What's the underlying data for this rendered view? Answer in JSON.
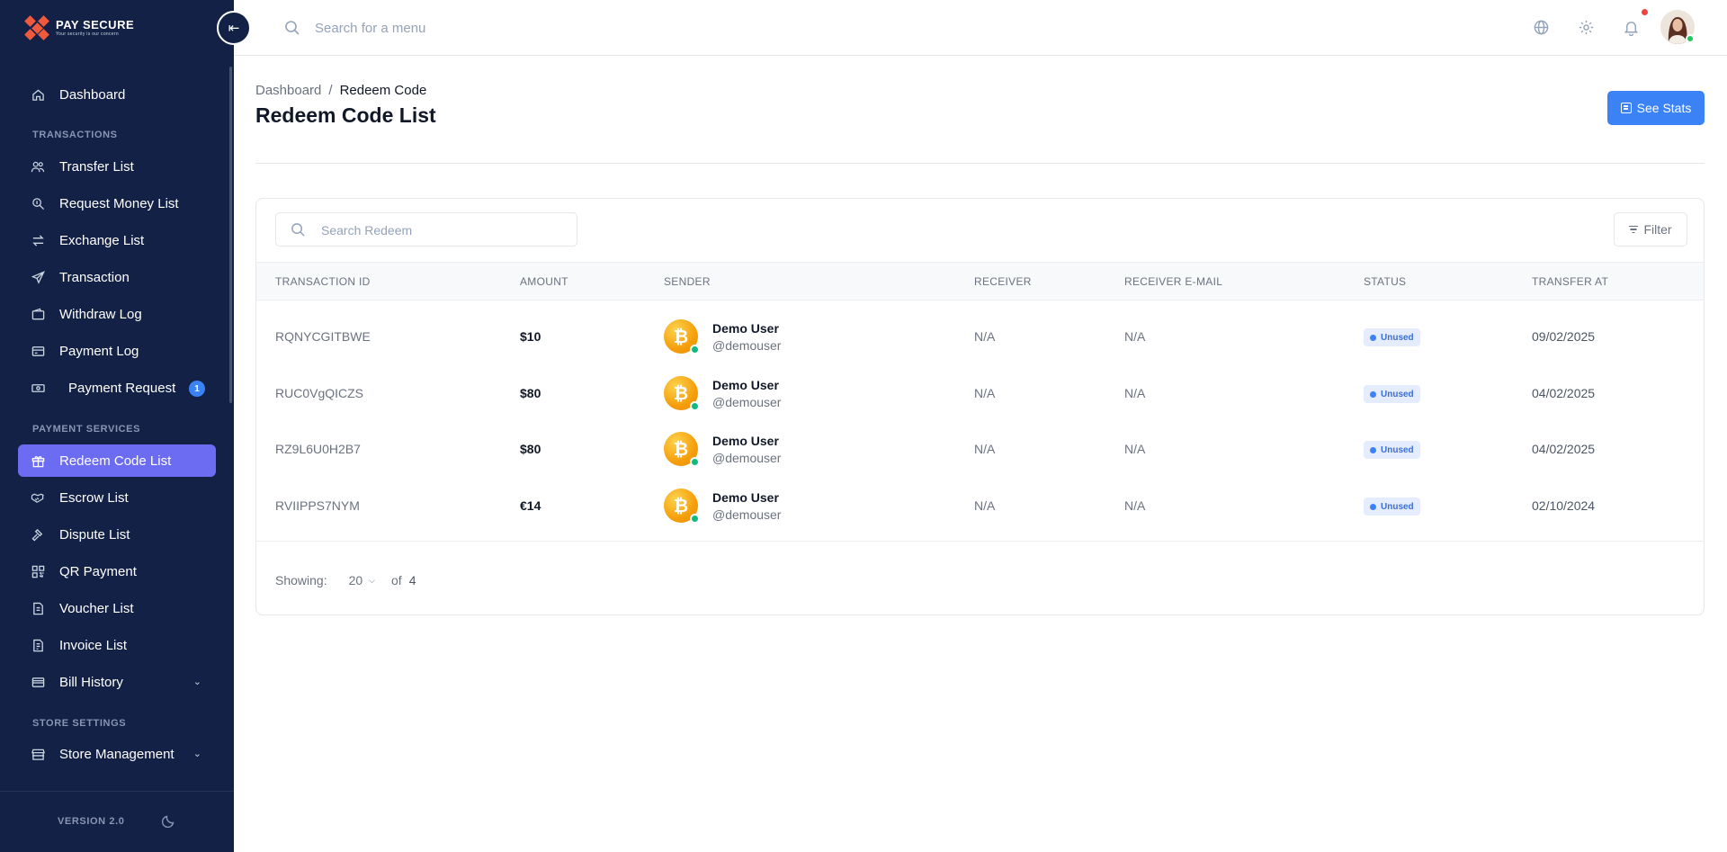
{
  "brand": {
    "name": "PAY SECURE",
    "tagline": "Your security is our concern"
  },
  "topbar": {
    "search_placeholder": "Search for a menu"
  },
  "sidebar": {
    "dashboard": "Dashboard",
    "section_transactions": "TRANSACTIONS",
    "transactions": [
      "Transfer List",
      "Request Money List",
      "Exchange List",
      "Transaction",
      "Withdraw Log",
      "Payment Log",
      "Payment Request"
    ],
    "payment_request_badge": "1",
    "section_payment_services": "PAYMENT SERVICES",
    "payment_services": [
      "Redeem Code List",
      "Escrow List",
      "Dispute List",
      "QR Payment",
      "Voucher List",
      "Invoice List",
      "Bill History"
    ],
    "section_store_settings": "STORE SETTINGS",
    "store_management": "Store Management",
    "version": "VERSION 2.0",
    "active_item": "Redeem Code List"
  },
  "breadcrumb": {
    "parent": "Dashboard",
    "separator": "/",
    "current": "Redeem Code"
  },
  "page_title": "Redeem Code List",
  "see_stats_label": "See Stats",
  "table": {
    "search_placeholder": "Search Redeem",
    "filter_label": "Filter",
    "columns": [
      "TRANSACTION ID",
      "AMOUNT",
      "SENDER",
      "RECEIVER",
      "RECEIVER E-MAIL",
      "STATUS",
      "TRANSFER AT"
    ],
    "rows": [
      {
        "id": "RQNYCGITBWE",
        "amount": "$10",
        "sender_name": "Demo User",
        "sender_username": "@demouser",
        "receiver": "N/A",
        "receiver_email": "N/A",
        "status": "Unused",
        "date": "09/02/2025"
      },
      {
        "id": "RUC0VgQICZS",
        "amount": "$80",
        "sender_name": "Demo User",
        "sender_username": "@demouser",
        "receiver": "N/A",
        "receiver_email": "N/A",
        "status": "Unused",
        "date": "04/02/2025"
      },
      {
        "id": "RZ9L6U0H2B7",
        "amount": "$80",
        "sender_name": "Demo User",
        "sender_username": "@demouser",
        "receiver": "N/A",
        "receiver_email": "N/A",
        "status": "Unused",
        "date": "04/02/2025"
      },
      {
        "id": "RVIIPPS7NYM",
        "amount": "€14",
        "sender_name": "Demo User",
        "sender_username": "@demouser",
        "receiver": "N/A",
        "receiver_email": "N/A",
        "status": "Unused",
        "date": "02/10/2024"
      }
    ],
    "coin_symbol": "₿"
  },
  "pagination": {
    "showing_label": "Showing:",
    "page_size": "20",
    "of_label": "of",
    "total": "4"
  },
  "colors": {
    "sidebar_bg": "#132146",
    "active_item": "#6b6cf2",
    "primary_button": "#3b82f6",
    "status_badge_bg": "#e4ecfd",
    "online": "#10b981"
  }
}
